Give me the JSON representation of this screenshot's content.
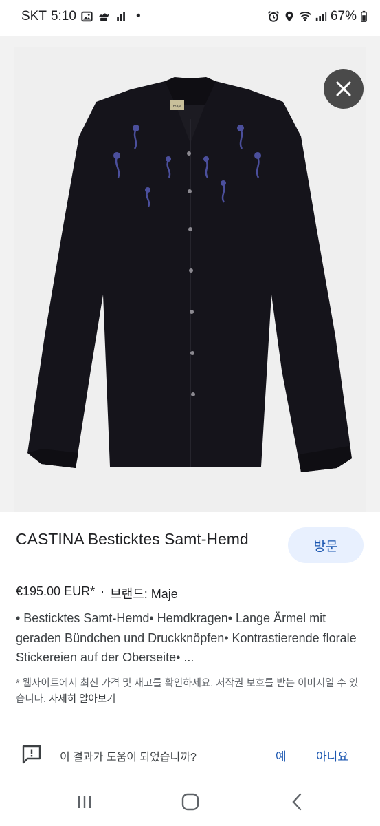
{
  "status_bar": {
    "carrier": "SKT",
    "time": "5:10",
    "dot": "•",
    "battery": "67%",
    "left_icons": [
      "image-icon",
      "chef-hat-icon",
      "chart-icon"
    ],
    "right_icons": [
      "alarm-icon",
      "location-icon",
      "wifi-icon",
      "signal-icon",
      "battery-icon"
    ]
  },
  "image": {
    "label_tag": "maje"
  },
  "close_icon": "close-icon",
  "product": {
    "title": "CASTINA Besticktes Samt-Hemd",
    "price": "€195.00 EUR*",
    "separator": "·",
    "brand": "브랜드: Maje",
    "description": "• Besticktes Samt-Hemd• Hemdkragen• Lange Ärmel mit geraden Bündchen und Druckknöpfen• Kontrastierende florale Stickereien auf der Oberseite• ...",
    "notice": "* 웹사이트에서 최신 가격 및 재고를 확인하세요. 저작권 보호를 받는 이미지일 수 있습니다.",
    "learn_more": "자세히 알아보기"
  },
  "visit_button": "방문",
  "feedback": {
    "question": "이 결과가 도움이 되었습니까?",
    "yes": "예",
    "no": "아니요"
  },
  "nav": {
    "recent_icon": "recent-apps-icon",
    "home_icon": "home-icon",
    "back_icon": "back-icon"
  },
  "colors": {
    "shirt": "#15141b",
    "embroidery": "#4b4f9c",
    "image_bg": "#efefef",
    "visit_bg": "#e8f0fe",
    "link": "#1a56b0"
  }
}
